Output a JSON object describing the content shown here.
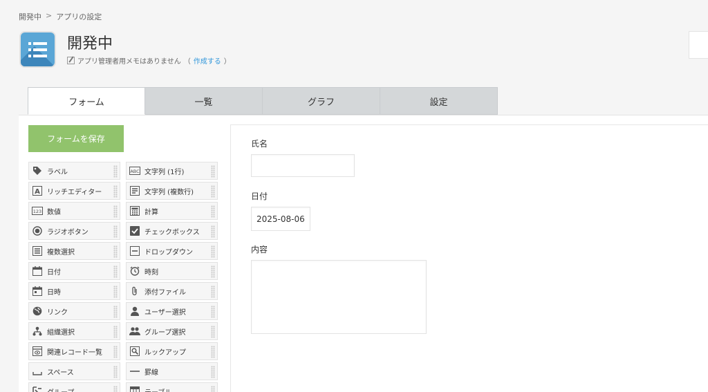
{
  "breadcrumb": {
    "root": "開発中",
    "separator": ">",
    "current": "アプリの設定"
  },
  "app": {
    "title": "開発中",
    "memo_text": "アプリ管理者用メモはありません",
    "memo_open": "（",
    "memo_link": "作成する",
    "memo_close": "）",
    "icon": "list-icon",
    "icon_color": "#5aa6d6"
  },
  "tabs": [
    {
      "label": "フォーム",
      "active": true
    },
    {
      "label": "一覧",
      "active": false
    },
    {
      "label": "グラフ",
      "active": false
    },
    {
      "label": "設定",
      "active": false
    }
  ],
  "save_button": {
    "label": "フォームを保存",
    "color": "#91c36c"
  },
  "palette": [
    {
      "label": "ラベル",
      "icon": "tag-icon"
    },
    {
      "label": "文字列 (1行)",
      "icon": "abc-icon"
    },
    {
      "label": "リッチエディター",
      "icon": "rich-text-icon"
    },
    {
      "label": "文字列 (複数行)",
      "icon": "multiline-text-icon"
    },
    {
      "label": "数値",
      "icon": "number-icon"
    },
    {
      "label": "計算",
      "icon": "calculator-icon"
    },
    {
      "label": "ラジオボタン",
      "icon": "radio-icon"
    },
    {
      "label": "チェックボックス",
      "icon": "checkbox-icon"
    },
    {
      "label": "複数選択",
      "icon": "multi-select-icon"
    },
    {
      "label": "ドロップダウン",
      "icon": "dropdown-icon"
    },
    {
      "label": "日付",
      "icon": "calendar-icon"
    },
    {
      "label": "時刻",
      "icon": "clock-icon"
    },
    {
      "label": "日時",
      "icon": "datetime-icon"
    },
    {
      "label": "添付ファイル",
      "icon": "paperclip-icon"
    },
    {
      "label": "リンク",
      "icon": "globe-icon"
    },
    {
      "label": "ユーザー選択",
      "icon": "user-icon"
    },
    {
      "label": "組織選択",
      "icon": "org-icon"
    },
    {
      "label": "グループ選択",
      "icon": "group-icon"
    },
    {
      "label": "関連レコード一覧",
      "icon": "related-records-icon"
    },
    {
      "label": "ルックアップ",
      "icon": "lookup-icon"
    },
    {
      "label": "スペース",
      "icon": "space-icon"
    },
    {
      "label": "罫線",
      "icon": "line-icon"
    },
    {
      "label": "グループ",
      "icon": "group-field-icon"
    },
    {
      "label": "テーブル",
      "icon": "table-icon"
    }
  ],
  "form": {
    "name_label": "氏名",
    "name_value": "",
    "date_label": "日付",
    "date_value": "2025-08-06",
    "content_label": "内容",
    "content_value": ""
  }
}
